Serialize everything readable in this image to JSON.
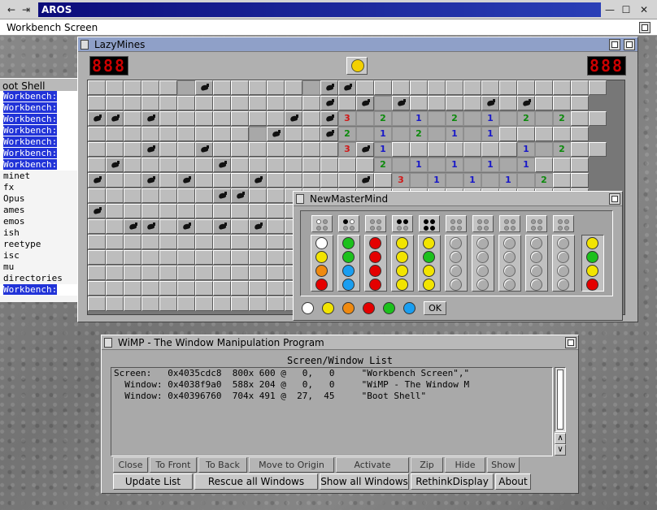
{
  "screen": {
    "title": "AROS",
    "screen_name": "Workbench Screen"
  },
  "shell": {
    "title": "oot Shell",
    "lines": [
      {
        "t": "Workbench:",
        "sel": true
      },
      {
        "t": "Workbench:",
        "sel": true
      },
      {
        "t": "Workbench:",
        "sel": true
      },
      {
        "t": "Workbench:",
        "sel": true
      },
      {
        "t": "Workbench:",
        "sel": true
      },
      {
        "t": "Workbench:",
        "sel": true
      },
      {
        "t": "Workbench:",
        "sel": true
      },
      {
        "t": "minet",
        "sel": false
      },
      {
        "t": "fx",
        "sel": false
      },
      {
        "t": "Opus",
        "sel": false
      },
      {
        "t": "ames",
        "sel": false
      },
      {
        "t": "emos",
        "sel": false
      },
      {
        "t": "ish",
        "sel": false
      },
      {
        "t": "reetype",
        "sel": false
      },
      {
        "t": "isc",
        "sel": false
      },
      {
        "t": "mu",
        "sel": false
      },
      {
        "t": " directories",
        "sel": false
      },
      {
        "t": "Workbench:",
        "sel": true
      }
    ]
  },
  "lazymines": {
    "title": "LazyMines",
    "mines_counter": "888",
    "time_counter": "888",
    "rows": [
      "ccccc mccccc mmcccccccccccccc",
      "cccccccccccccmcm mccccmcmccc",
      "mmcmcccccccmcm3 2 1 2 1 2 2cc",
      "ccccccccc mccm2 1 2 1 1ccccc",
      "cccmccmccccccc3m1ccccccc1 2cc",
      "cmcccccmcccccccc2 1 1 1 1ccc",
      "mccmcmcccmcccccmc3 1 1 1 2cc",
      "cccccccmmccccccccccccccccccc",
      "mcccccccccccccccccccccccccccc",
      "ccmmcmcmcmcccccccccccccccccc",
      "ccccccccccccccccccccccccccccc",
      "cccccccccccccccccccccccccccc",
      "cccccccccccccccccccccccccccc",
      "ccccccccccccccccccccccccccc",
      "cccccccccccccccccccccccccccc"
    ]
  },
  "mastermind": {
    "title": "NewMasterMind",
    "ok_label": "OK",
    "palette": [
      "#ffffff",
      "#f2e400",
      "#ef8a10",
      "#e40000",
      "#1cc11c",
      "#1a9ef0"
    ],
    "guesses": [
      [
        "#ffffff",
        "#f2e400",
        "#ef8a10",
        "#e40000"
      ],
      [
        "#1cc11c",
        "#1cc11c",
        "#1a9ef0",
        "#1a9ef0"
      ],
      [
        "#e40000",
        "#e40000",
        "#e40000",
        "#e40000"
      ],
      [
        "#f2e400",
        "#f2e400",
        "#f2e400",
        "#f2e400"
      ],
      [
        "#f2e400",
        "#1cc11c",
        "#f2e400",
        "#f2e400"
      ]
    ],
    "feedback": [
      [
        1,
        0,
        0,
        0
      ],
      [
        2,
        1,
        0,
        0
      ],
      [
        0,
        0,
        0,
        0
      ],
      [
        2,
        2,
        0,
        0
      ],
      [
        2,
        2,
        2,
        2
      ]
    ],
    "secret": [
      "#f2e400",
      "#1cc11c",
      "#f2e400",
      "#e40000"
    ]
  },
  "wimp": {
    "title": "WiMP - The Window Manipulation Program",
    "list_header": "Screen/Window List",
    "rows": [
      "Screen:   0x4035cdc8  800x 600 @   0,   0     \"Workbench Screen\",\"",
      "  Window: 0x4038f9a0  588x 204 @   0,   0     \"WiMP - The Window M",
      "  Window: 0x40396760  704x 491 @  27,  45     \"Boot Shell\""
    ],
    "buttons": [
      "Close",
      "To Front",
      "To Back",
      "Move to Origin",
      "Activate",
      "Zip",
      "Hide",
      "Show"
    ],
    "buttons2": [
      "Update List",
      "Rescue all Windows",
      "Show all Windows",
      "RethinkDisplay",
      "About"
    ]
  }
}
